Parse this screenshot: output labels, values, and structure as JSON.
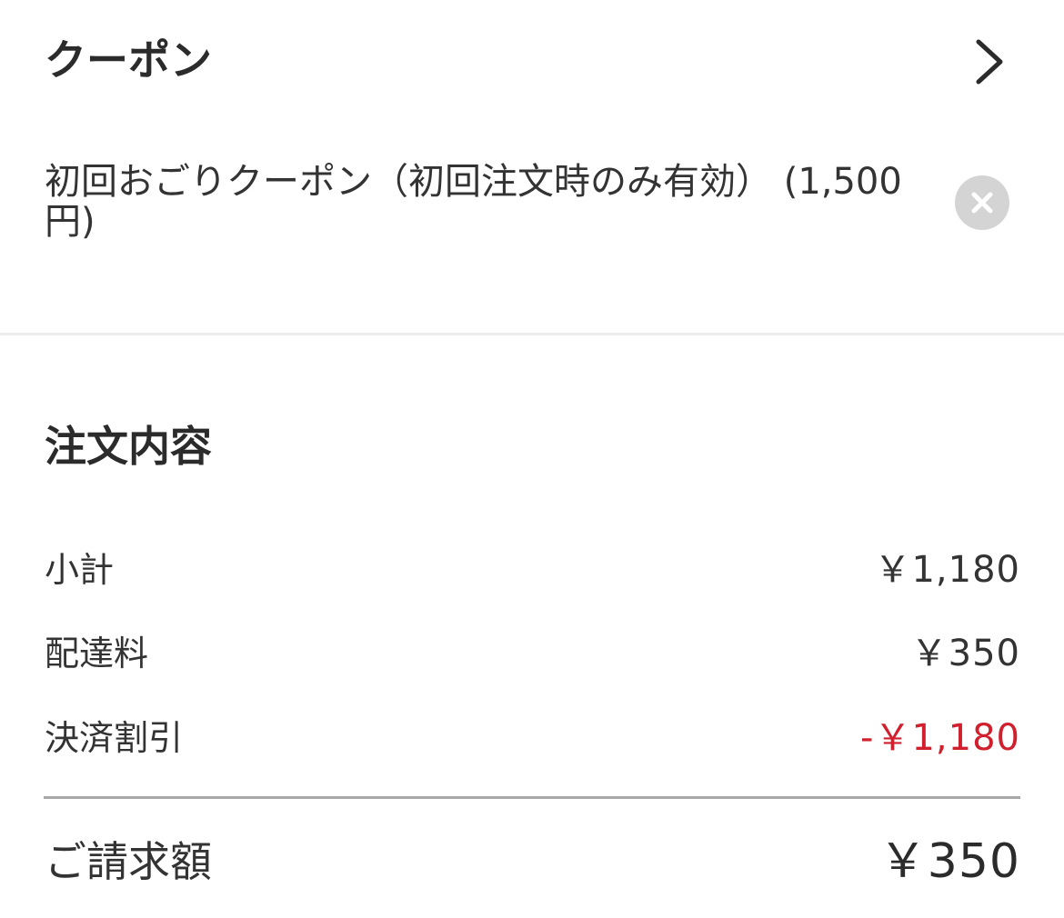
{
  "coupon": {
    "title": "クーポン",
    "applied_coupon": "初回おごりクーポン（初回注文時のみ有効） (1,500円)"
  },
  "order": {
    "title": "注文内容",
    "items": [
      {
        "label": "小計",
        "value": "￥1,180"
      },
      {
        "label": "配達料",
        "value": "￥350"
      },
      {
        "label": "決済割引",
        "value": "-￥1,180"
      }
    ],
    "total": {
      "label": "ご請求額",
      "value": "￥350"
    }
  },
  "colors": {
    "text": "#2b2b2b",
    "discount": "#d0202e",
    "remove_button_bg": "#d4d4d4",
    "divider": "#ececec",
    "total_divider": "#a8a8a8"
  },
  "icons": {
    "coupon_arrow": "chevron-right-icon",
    "remove_coupon": "close-icon"
  }
}
